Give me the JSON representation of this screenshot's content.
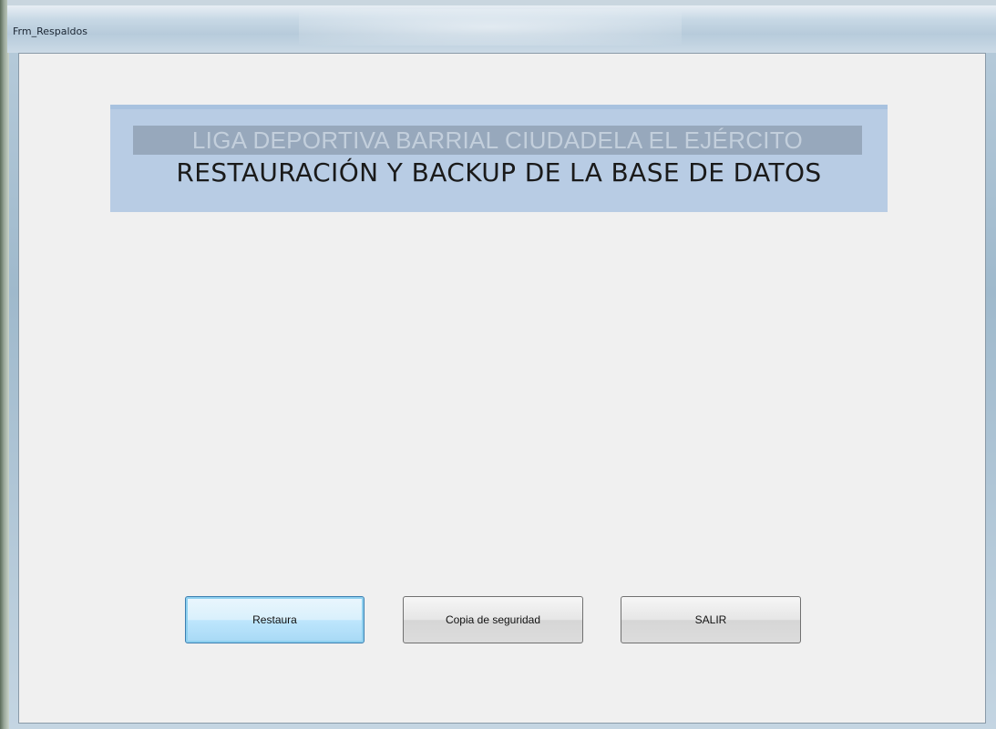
{
  "window": {
    "title": "Frm_Respaldos"
  },
  "banner": {
    "subtitle": "LIGA DEPORTIVA BARRIAL CIUDADELA EL EJÉRCITO",
    "title": "RESTAURACIÓN Y BACKUP DE LA BASE DE DATOS"
  },
  "buttons": {
    "restore_label": "Restaura",
    "backup_label": "Copia de seguridad",
    "exit_label": "SALIR"
  },
  "colors": {
    "banner_background": "#b8cce4",
    "banner_subtitle_bar": "#97a8bc",
    "client_background": "#f0f0f0",
    "focused_button_border": "#3c7fb1"
  }
}
